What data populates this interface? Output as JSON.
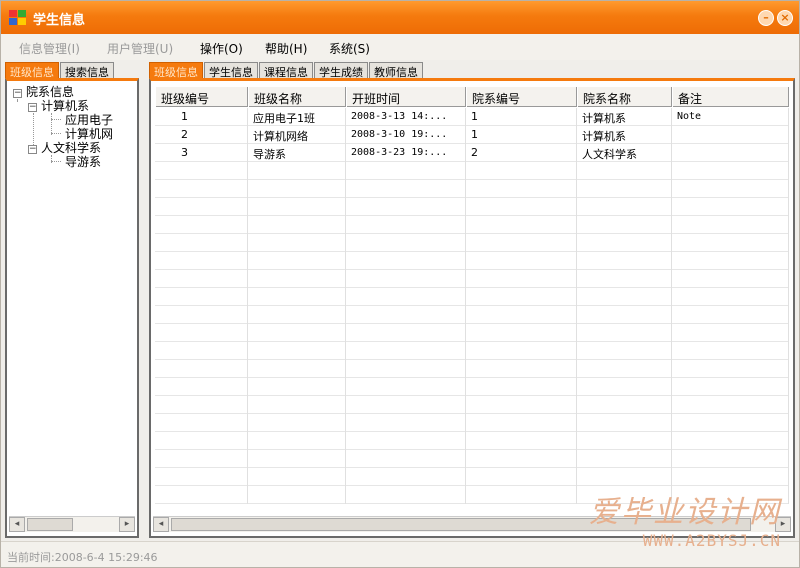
{
  "window": {
    "title": "学生信息",
    "minimize_glyph": "–",
    "close_glyph": "×"
  },
  "menu": {
    "items": [
      {
        "label": "信息管理(I)",
        "enabled": false
      },
      {
        "label": "用户管理(U)",
        "enabled": false
      },
      {
        "label": "操作(O)",
        "enabled": true
      },
      {
        "label": "帮助(H)",
        "enabled": true
      },
      {
        "label": "系统(S)",
        "enabled": true
      }
    ]
  },
  "left_tabs": [
    {
      "label": "班级信息",
      "active": true
    },
    {
      "label": "搜索信息",
      "active": false
    }
  ],
  "tree": {
    "root": "院系信息",
    "children": [
      {
        "label": "计算机系",
        "children": [
          "应用电子",
          "计算机网"
        ]
      },
      {
        "label": "人文科学系",
        "children": [
          "导游系"
        ]
      }
    ],
    "expander_glyph": "−"
  },
  "right_tabs": [
    {
      "label": "班级信息",
      "active": true
    },
    {
      "label": "学生信息",
      "active": false
    },
    {
      "label": "课程信息",
      "active": false
    },
    {
      "label": "学生成绩",
      "active": false
    },
    {
      "label": "教师信息",
      "active": false
    }
  ],
  "table": {
    "columns": [
      "班级编号",
      "班级名称",
      "开班时间",
      "院系编号",
      "院系名称",
      "备注"
    ],
    "rows": [
      [
        "1",
        "应用电子1班",
        "2008-3-13 14:...",
        "1",
        "计算机系",
        "Note"
      ],
      [
        "2",
        "计算机网络",
        "2008-3-10 19:...",
        "1",
        "计算机系",
        ""
      ],
      [
        "3",
        "导游系",
        "2008-3-23 19:...",
        "2",
        "人文科学系",
        ""
      ]
    ]
  },
  "status": {
    "text": "当前时间:2008-6-4 15:29:46"
  },
  "scroll": {
    "left_arrow": "◂",
    "right_arrow": "▸"
  },
  "watermark": {
    "line1": "爱毕业设计网",
    "line2": "WWW.A2BYSJ.CN"
  },
  "colors": {
    "accent": "#f57a0e",
    "title_gradient_top": "#ff9a2e"
  }
}
